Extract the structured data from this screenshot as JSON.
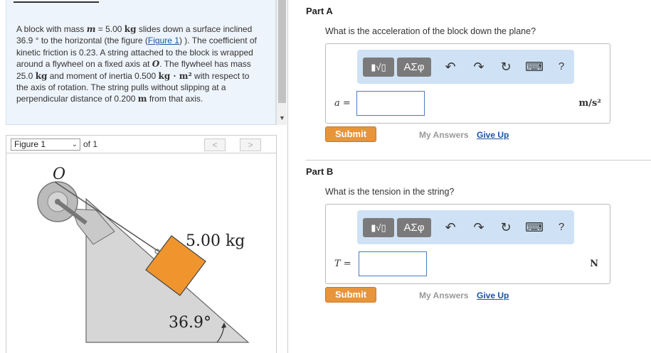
{
  "problem": {
    "header_fragment": "",
    "text": {
      "p1": "A block with mass ",
      "m_sym": "m",
      "p2": " = 5.00 ",
      "kg1": "kg",
      "p3": " slides down a surface inclined 36.9 ° to the horizontal (the figure (",
      "figure_link": "Figure 1",
      "p4": ") ). The coefficient of kinetic friction is 0.23. A string attached to the block is wrapped around a flywheel on a fixed axis at ",
      "O_sym": "O",
      "p5": ". The flywheel has mass 25.0 ",
      "kg2": "kg",
      "p6": " and moment of inertia 0.500 ",
      "kgm2": "kg · m²",
      "p7": " with respect to the axis of rotation. The string pulls without slipping at a perpendicular distance of 0.200 ",
      "m_unit": "m",
      "p8": " from that axis."
    }
  },
  "figure_nav": {
    "selected": "Figure 1",
    "of_label": "of 1",
    "prev": "<",
    "next": ">"
  },
  "figure": {
    "axis_label": "O",
    "mass_label": "5.00 kg",
    "angle_label": "36.9°",
    "block_color": "#f0952e",
    "incline_color": "#d6d6d6"
  },
  "parts": [
    {
      "title": "Part A",
      "question": "What is the acceleration of the block down the plane?",
      "variable": "a =",
      "unit": "m/s²",
      "value": "",
      "submit": "Submit",
      "my_answers": "My Answers",
      "give_up": "Give Up"
    },
    {
      "title": "Part B",
      "question": "What is the tension in the string?",
      "variable": "T =",
      "unit": "N",
      "value": "",
      "submit": "Submit",
      "my_answers": "My Answers",
      "give_up": "Give Up"
    }
  ],
  "toolbar": {
    "templates": "▮√▯",
    "greek": "ΑΣφ",
    "undo": "↶",
    "redo": "↷",
    "reset": "↻",
    "keyboard": "⌨",
    "help": "?"
  },
  "colors": {
    "accent_orange": "#e8943a",
    "link_blue": "#1a55a3",
    "toolbar_bg": "#cfe2f5"
  }
}
